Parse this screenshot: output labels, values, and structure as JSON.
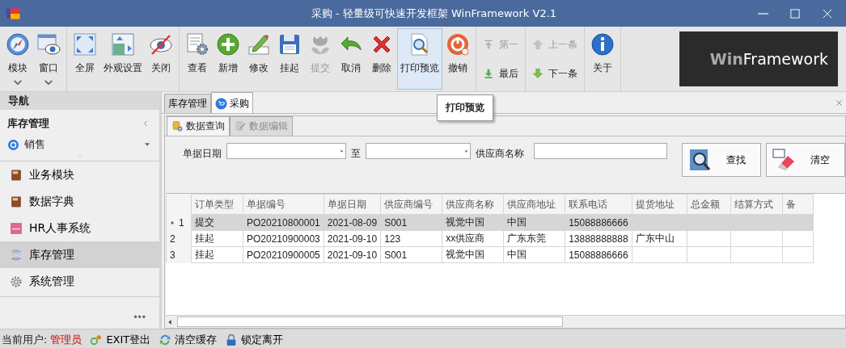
{
  "window": {
    "title": "采购 - 轻量级可快速开发框架 WinFramework V2.1"
  },
  "toolbar": {
    "groups": [
      {
        "buttons": [
          {
            "label": "模块",
            "kind": "large",
            "disabled": false,
            "highlighted": false,
            "has_menu": true
          },
          {
            "label": "窗口",
            "kind": "large",
            "disabled": false,
            "highlighted": false,
            "has_menu": true
          }
        ]
      },
      {
        "buttons": [
          {
            "label": "全屏",
            "kind": "large",
            "disabled": false,
            "highlighted": false,
            "has_menu": false
          },
          {
            "label": "外观设置",
            "kind": "large",
            "disabled": false,
            "highlighted": false,
            "has_menu": false
          },
          {
            "label": "关闭",
            "kind": "large",
            "disabled": false,
            "highlighted": false,
            "has_menu": false
          }
        ]
      },
      {
        "buttons": [
          {
            "label": "查看",
            "kind": "large",
            "disabled": false,
            "highlighted": false,
            "has_menu": false
          },
          {
            "label": "新增",
            "kind": "large",
            "disabled": false,
            "highlighted": false,
            "has_menu": false
          },
          {
            "label": "修改",
            "kind": "large",
            "disabled": false,
            "highlighted": false,
            "has_menu": false
          },
          {
            "label": "挂起",
            "kind": "large",
            "disabled": false,
            "highlighted": false,
            "has_menu": false
          },
          {
            "label": "提交",
            "kind": "large",
            "disabled": true,
            "highlighted": false,
            "has_menu": false
          },
          {
            "label": "取消",
            "kind": "large",
            "disabled": false,
            "highlighted": false,
            "has_menu": false
          },
          {
            "label": "删除",
            "kind": "large",
            "disabled": false,
            "highlighted": false,
            "has_menu": false
          },
          {
            "label": "打印预览",
            "kind": "large",
            "disabled": false,
            "highlighted": true,
            "has_menu": false
          },
          {
            "label": "撤销",
            "kind": "large",
            "disabled": false,
            "highlighted": false,
            "has_menu": false
          }
        ]
      },
      {
        "buttons": [
          {
            "label": "第一",
            "kind": "small",
            "disabled": true
          },
          {
            "label": "最后",
            "kind": "small",
            "disabled": false
          }
        ]
      },
      {
        "buttons": [
          {
            "label": "上一条",
            "kind": "small",
            "disabled": true
          },
          {
            "label": "下一条",
            "kind": "small",
            "disabled": false
          }
        ]
      },
      {
        "buttons": [
          {
            "label": "关于",
            "kind": "large",
            "disabled": false,
            "highlighted": false,
            "has_menu": false
          }
        ]
      }
    ],
    "logo_text": "**Win**Framework"
  },
  "tooltip": "打印预览",
  "navigation": {
    "title": "导航",
    "section": "库存管理",
    "selector": "销售",
    "items": [
      {
        "label": "业务模块",
        "selected": false
      },
      {
        "label": "数据字典",
        "selected": false
      },
      {
        "label": "HR人事系统",
        "selected": false
      },
      {
        "label": "库存管理",
        "selected": true
      },
      {
        "label": "系统管理",
        "selected": false
      }
    ],
    "more": "•••"
  },
  "document_tabs": [
    {
      "label": "库存管理",
      "selected": false
    },
    {
      "label": "采购",
      "selected": true
    }
  ],
  "sub_tabs": [
    {
      "label": "数据查询",
      "selected": true
    },
    {
      "label": "数据编辑",
      "selected": false
    }
  ],
  "filters": {
    "date_label": "单据日期",
    "to_label": "至",
    "supplier_label": "供应商名称",
    "buttons": [
      "查找",
      "清空"
    ]
  },
  "table": {
    "columns": [
      "订单类型",
      "单据编号",
      "单据日期",
      "供应商编号",
      "供应商名称",
      "供应商地址",
      "联系电话",
      "提货地址",
      "总金额",
      "结算方式",
      "备"
    ],
    "rows": [
      {
        "number": "1",
        "selected": true,
        "cells": [
          "提交",
          "PO20210800001",
          "2021-08-09",
          "S001",
          "视觉中国",
          "中国",
          "15088886666",
          "",
          "",
          "",
          ""
        ]
      },
      {
        "number": "2",
        "selected": false,
        "cells": [
          "挂起",
          "PO20210900003",
          "2021-09-10",
          "123",
          "xx供应商",
          "广东东莞",
          "13888888888",
          "广东中山",
          "",
          "",
          ""
        ]
      },
      {
        "number": "3",
        "selected": false,
        "cells": [
          "挂起",
          "PO20210900005",
          "2021-09-10",
          "S001",
          "视觉中国",
          "中国",
          "15088886666",
          "",
          "",
          "",
          ""
        ]
      }
    ]
  },
  "status_bar": {
    "user_label": "当前用户:",
    "user": "管理员",
    "actions": [
      "EXIT登出",
      "清空缓存",
      "锁定离开"
    ]
  }
}
